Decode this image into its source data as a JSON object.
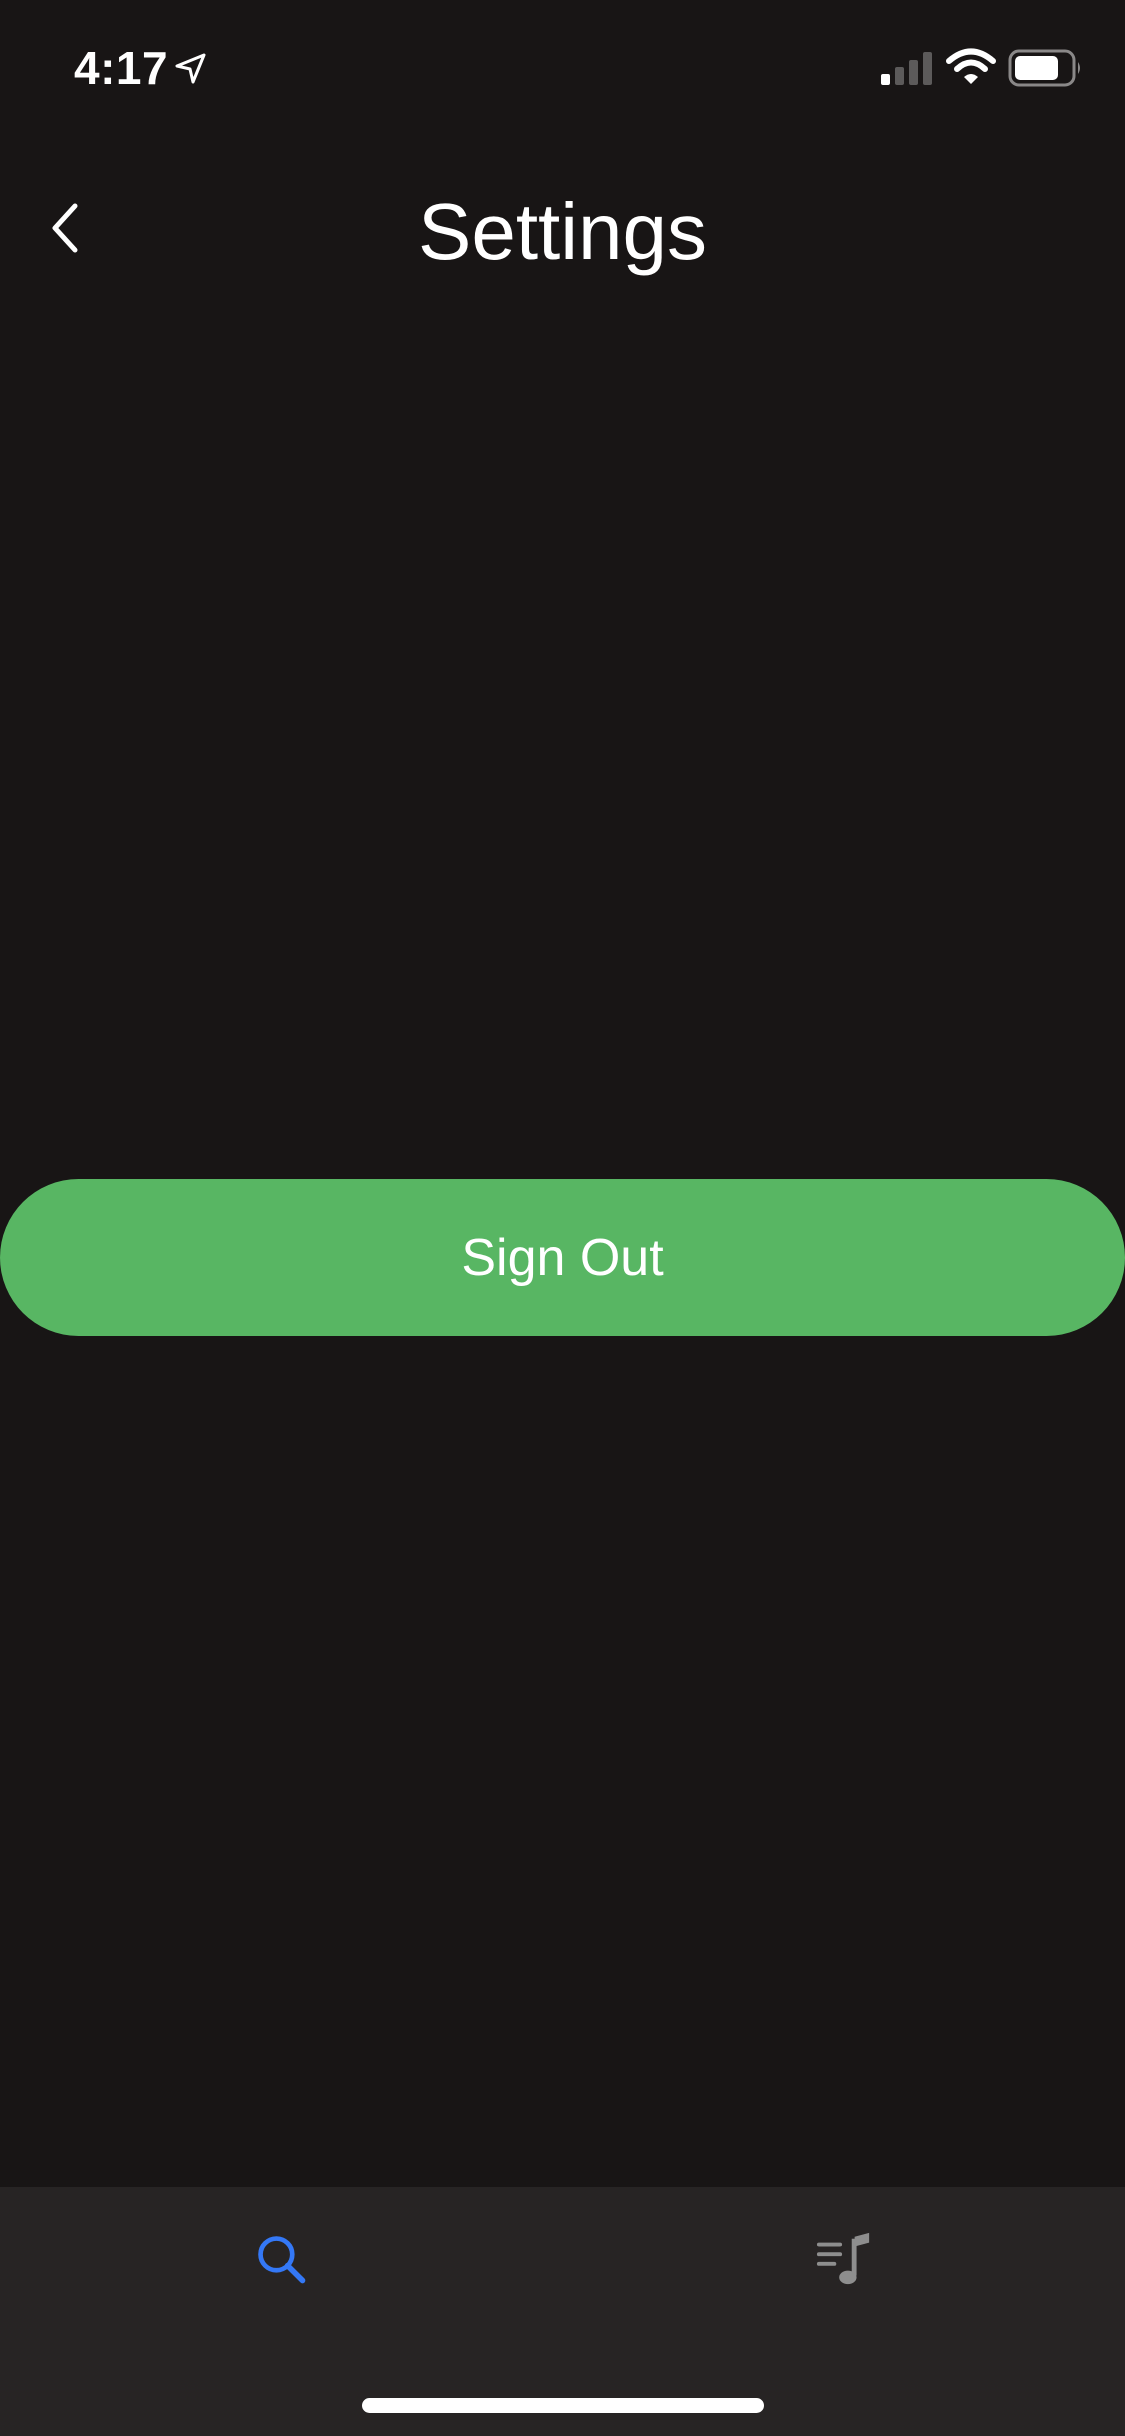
{
  "status_bar": {
    "time": "4:17",
    "icons": [
      "location-arrow-icon",
      "cellular-signal-icon",
      "wifi-icon",
      "battery-icon"
    ]
  },
  "nav": {
    "title": "Settings",
    "back_icon": "chevron-left-icon"
  },
  "main": {
    "sign_out_label": "Sign Out"
  },
  "tab_bar": {
    "tabs": [
      {
        "icon": "search-icon",
        "selected": true
      },
      {
        "icon": "music-playlist-icon",
        "selected": false
      }
    ]
  },
  "colors": {
    "background": "#181515",
    "tab_bar_background": "#272424",
    "accent_green": "#58b663",
    "active_tab_blue": "#3478f6",
    "inactive_tab_gray": "#8e8e8e"
  }
}
